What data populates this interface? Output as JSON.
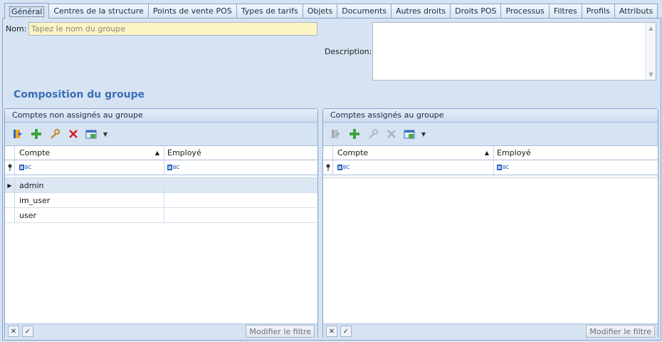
{
  "tabs": [
    "Général",
    "Centres de la structure",
    "Points de vente POS",
    "Types de tarifs",
    "Objets",
    "Documents",
    "Autres droits",
    "Droits POS",
    "Processus",
    "Filtres",
    "Profils",
    "Attributs"
  ],
  "form": {
    "name_label": "Nom:",
    "name_placeholder": "Tapez le nom du groupe",
    "name_value": "",
    "description_label": "Description:",
    "description_value": ""
  },
  "section_title": "Composition du groupe",
  "left_panel": {
    "title": "Comptes non assignés au groupe",
    "columns": [
      "Compte",
      "Employé"
    ],
    "rows": [
      {
        "compte": "admin",
        "employe": ""
      },
      {
        "compte": "im_user",
        "employe": ""
      },
      {
        "compte": "user",
        "employe": ""
      }
    ],
    "modify_filter_label": "Modifier le filtre"
  },
  "right_panel": {
    "title": "Comptes assignés au groupe",
    "columns": [
      "Compte",
      "Employé"
    ],
    "rows": [],
    "modify_filter_label": "Modifier le filtre"
  },
  "filter_icon_text": "BC",
  "filter_icon_prefix": "a",
  "colors": {
    "background": "#d6e3f3",
    "name_input_bg": "#fbf4c4",
    "section_title": "#3b6fb6",
    "border": "#8aa4c8"
  }
}
